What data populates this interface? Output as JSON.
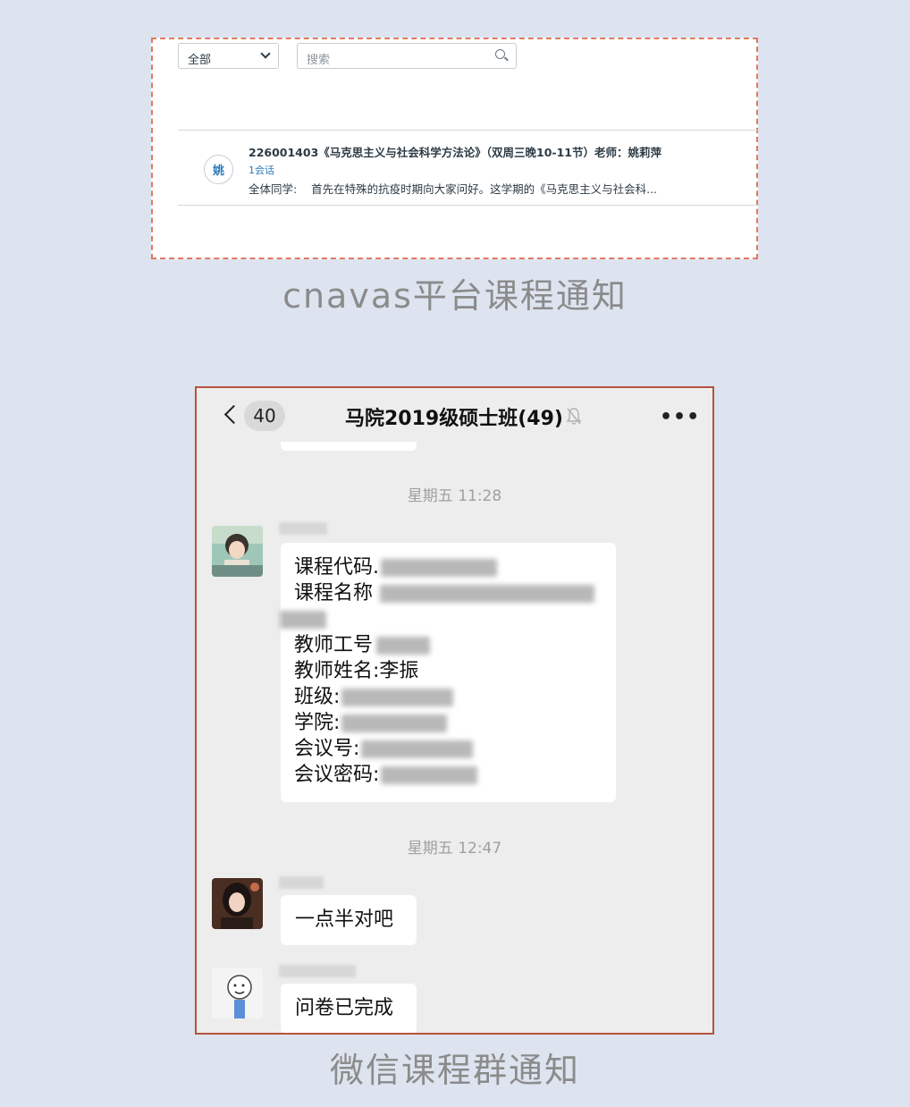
{
  "canvas": {
    "filter": "全部",
    "search_placeholder": "搜索",
    "message": {
      "avatar_text": "姚",
      "title": "226001403《马克思主义与社会科学方法论》（双周三晚10-11节）老师：姚莉萍",
      "count": "1会话",
      "snippet": "全体同学:    首先在特殊的抗疫时期向大家问好。这学期的《马克思主义与社会科..."
    },
    "caption": "cnavas平台课程通知"
  },
  "wechat": {
    "unread_count": "40",
    "title": "马院2019级硕士班(49)",
    "more": "•••",
    "time1": "星期五 11:28",
    "info_lines": [
      "课程代码.",
      "课程名称",
      "",
      "教师工号",
      "教师姓名:李振",
      "班级:",
      "学院:",
      "会议号:",
      "会议密码:"
    ],
    "time2": "星期五 12:47",
    "msg2": "一点半对吧",
    "msg3": "问卷已完成",
    "caption": "微信课程群通知"
  }
}
